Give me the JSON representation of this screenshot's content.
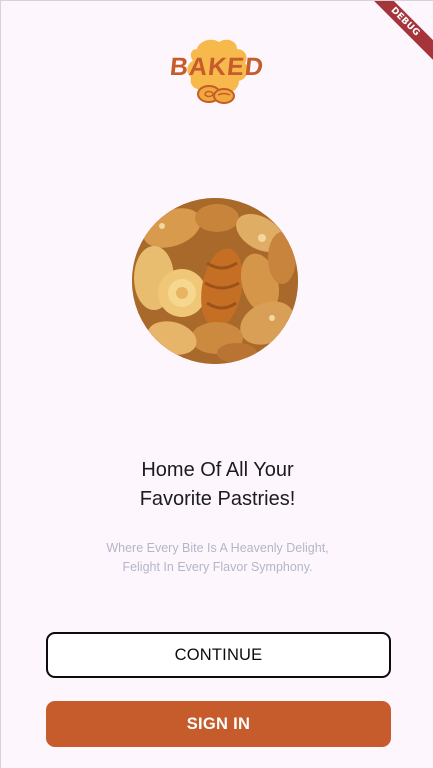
{
  "app": {
    "logo_text": "BAKED",
    "debug_banner": "DEBUG"
  },
  "hero": {
    "image_icon": "pastries-photo"
  },
  "intro": {
    "title_line1": "Home Of All Your",
    "title_line2": "Favorite Pastries!",
    "subtitle_line1": "Where Every Bite Is A Heavenly Delight,",
    "subtitle_line2": "Felight In Every Flavor Symphony."
  },
  "actions": {
    "continue_label": "CONTINUE",
    "signin_label": "SIGN IN"
  },
  "colors": {
    "brand": "#c65b2c",
    "logo_blob": "#f7b84c",
    "background": "#fdf7fd",
    "subtitle": "#b3b6c8",
    "debug": "#a5343b"
  }
}
